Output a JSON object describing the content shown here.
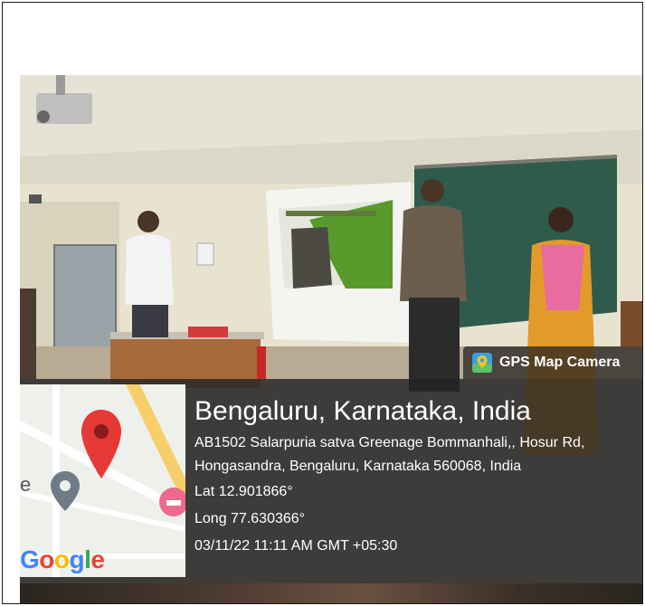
{
  "badge": {
    "app_name": "GPS Map Camera",
    "icon": "gps-map-camera-app-icon"
  },
  "location": {
    "city": "Bengaluru, Karnataka, India",
    "address": "AB1502 Salarpuria satva Greenage Bommanhali,, Hosur Rd, Hongasandra, Bengaluru, Karnataka 560068, India",
    "lat": "Lat 12.901866°",
    "long": "Long 77.630366°",
    "datetime": "03/11/22 11:11 AM GMT +05:30"
  },
  "map": {
    "logo_text": "Google",
    "edge_letter": "e",
    "pin_color": "#e53935"
  },
  "colors": {
    "overlay": "#232326",
    "google_blue": "#4285f4",
    "google_red": "#ea4335",
    "google_yellow": "#fbbc05",
    "google_green": "#34a853"
  }
}
